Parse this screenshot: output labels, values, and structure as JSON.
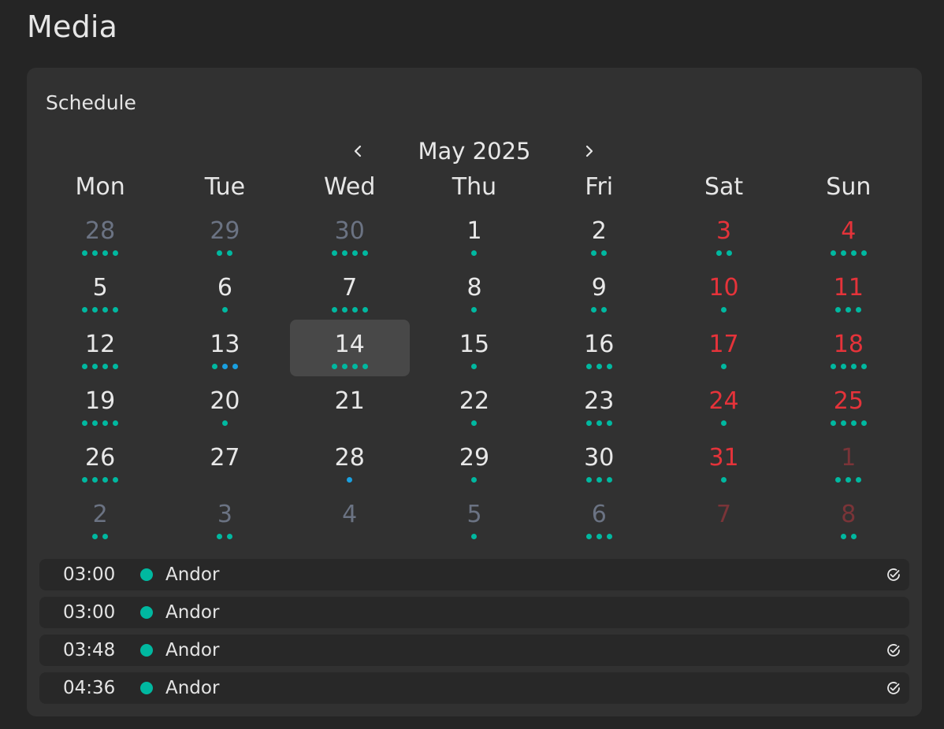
{
  "page": {
    "title": "Media"
  },
  "schedule": {
    "title": "Schedule",
    "month_label": "May 2025",
    "prev_icon": "chevron-left-icon",
    "next_icon": "chevron-right-icon",
    "weekdays": [
      "Mon",
      "Tue",
      "Wed",
      "Thu",
      "Fri",
      "Sat",
      "Sun"
    ],
    "colors": {
      "text_current": "#e8e8e8",
      "text_other_month": "#6b7383",
      "text_weekend": "#e5333a",
      "text_weekend_other_month": "#7a3438",
      "dot_teal": "#00b8a0",
      "dot_blue": "#1aa0e0",
      "selected_bg": "#484848"
    },
    "days": [
      {
        "day": "28",
        "state": "other",
        "dots": [
          "teal",
          "teal",
          "teal",
          "teal"
        ]
      },
      {
        "day": "29",
        "state": "other",
        "dots": [
          "teal",
          "teal"
        ]
      },
      {
        "day": "30",
        "state": "other",
        "dots": [
          "teal",
          "teal",
          "teal",
          "teal"
        ]
      },
      {
        "day": "1",
        "state": "current",
        "dots": [
          "teal"
        ]
      },
      {
        "day": "2",
        "state": "current",
        "dots": [
          "teal",
          "teal"
        ]
      },
      {
        "day": "3",
        "state": "weekend",
        "dots": [
          "teal",
          "teal"
        ]
      },
      {
        "day": "4",
        "state": "weekend",
        "dots": [
          "teal",
          "teal",
          "teal",
          "teal"
        ]
      },
      {
        "day": "5",
        "state": "current",
        "dots": [
          "teal",
          "teal",
          "teal",
          "teal"
        ]
      },
      {
        "day": "6",
        "state": "current",
        "dots": [
          "teal"
        ]
      },
      {
        "day": "7",
        "state": "current",
        "dots": [
          "teal",
          "teal",
          "teal",
          "teal"
        ]
      },
      {
        "day": "8",
        "state": "current",
        "dots": [
          "teal"
        ]
      },
      {
        "day": "9",
        "state": "current",
        "dots": [
          "teal",
          "teal"
        ]
      },
      {
        "day": "10",
        "state": "weekend",
        "dots": [
          "teal"
        ]
      },
      {
        "day": "11",
        "state": "weekend",
        "dots": [
          "teal",
          "teal",
          "teal"
        ]
      },
      {
        "day": "12",
        "state": "current",
        "dots": [
          "teal",
          "teal",
          "teal",
          "teal"
        ]
      },
      {
        "day": "13",
        "state": "current",
        "dots": [
          "teal",
          "blue",
          "blue"
        ]
      },
      {
        "day": "14",
        "state": "current",
        "selected": true,
        "dots": [
          "teal",
          "teal",
          "teal",
          "teal"
        ]
      },
      {
        "day": "15",
        "state": "current",
        "dots": [
          "teal"
        ]
      },
      {
        "day": "16",
        "state": "current",
        "dots": [
          "teal",
          "teal",
          "teal"
        ]
      },
      {
        "day": "17",
        "state": "weekend",
        "dots": [
          "teal"
        ]
      },
      {
        "day": "18",
        "state": "weekend",
        "dots": [
          "teal",
          "teal",
          "teal",
          "teal"
        ]
      },
      {
        "day": "19",
        "state": "current",
        "dots": [
          "teal",
          "teal",
          "teal",
          "teal"
        ]
      },
      {
        "day": "20",
        "state": "current",
        "dots": [
          "teal"
        ]
      },
      {
        "day": "21",
        "state": "current",
        "dots": []
      },
      {
        "day": "22",
        "state": "current",
        "dots": [
          "teal"
        ]
      },
      {
        "day": "23",
        "state": "current",
        "dots": [
          "teal",
          "teal",
          "teal"
        ]
      },
      {
        "day": "24",
        "state": "weekend",
        "dots": [
          "teal"
        ]
      },
      {
        "day": "25",
        "state": "weekend",
        "dots": [
          "teal",
          "teal",
          "teal",
          "teal"
        ]
      },
      {
        "day": "26",
        "state": "current",
        "dots": [
          "teal",
          "teal",
          "teal",
          "teal"
        ]
      },
      {
        "day": "27",
        "state": "current",
        "dots": []
      },
      {
        "day": "28",
        "state": "current",
        "dots": [
          "blue"
        ]
      },
      {
        "day": "29",
        "state": "current",
        "dots": [
          "teal"
        ]
      },
      {
        "day": "30",
        "state": "current",
        "dots": [
          "teal",
          "teal",
          "teal"
        ]
      },
      {
        "day": "31",
        "state": "weekend",
        "dots": [
          "teal"
        ]
      },
      {
        "day": "1",
        "state": "weekend-other",
        "dots": [
          "teal",
          "teal",
          "teal"
        ]
      },
      {
        "day": "2",
        "state": "other",
        "dots": [
          "teal",
          "teal"
        ]
      },
      {
        "day": "3",
        "state": "other",
        "dots": [
          "teal",
          "teal"
        ]
      },
      {
        "day": "4",
        "state": "other",
        "dots": []
      },
      {
        "day": "5",
        "state": "other",
        "dots": [
          "teal"
        ]
      },
      {
        "day": "6",
        "state": "other",
        "dots": [
          "teal",
          "teal",
          "teal"
        ]
      },
      {
        "day": "7",
        "state": "weekend-other",
        "dots": []
      },
      {
        "day": "8",
        "state": "weekend-other",
        "dots": [
          "teal",
          "teal"
        ]
      }
    ],
    "events": [
      {
        "time": "03:00",
        "title": "Andor",
        "color": "#00b8a0",
        "checked": true
      },
      {
        "time": "03:00",
        "title": "Andor",
        "color": "#00b8a0",
        "checked": false
      },
      {
        "time": "03:48",
        "title": "Andor",
        "color": "#00b8a0",
        "checked": true
      },
      {
        "time": "04:36",
        "title": "Andor",
        "color": "#00b8a0",
        "checked": true
      }
    ]
  }
}
